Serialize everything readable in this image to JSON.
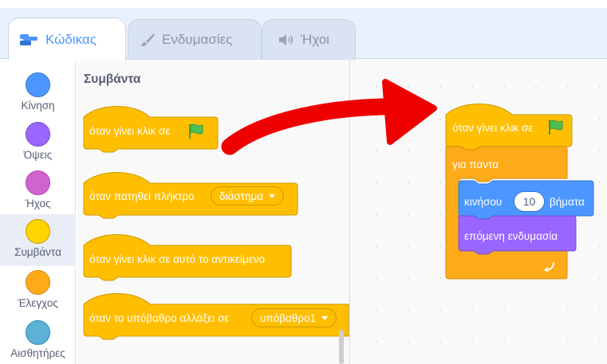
{
  "tabs": [
    {
      "label": "Κώδικας",
      "icon": "code-icon",
      "active": true
    },
    {
      "label": "Ενδυμασίες",
      "icon": "costume-brush-icon",
      "active": false
    },
    {
      "label": "Ήχοι",
      "icon": "sound-icon",
      "active": false
    }
  ],
  "categories": [
    {
      "label": "Κίνηση",
      "color": "#4c97ff"
    },
    {
      "label": "Όψεις",
      "color": "#9966ff"
    },
    {
      "label": "Ήχος",
      "color": "#cf63cf"
    },
    {
      "label": "Συμβάντα",
      "color": "#ffd500",
      "selected": true
    },
    {
      "label": "Έλεγχος",
      "color": "#ffab19"
    },
    {
      "label": "Αισθητήρες",
      "color": "#5cb1d6"
    }
  ],
  "palette": {
    "title": "Συμβάντα",
    "blocks": {
      "flag_clicked": "όταν γίνει κλικ σε",
      "key_pressed": "όταν πατηθεί πλήκτρο",
      "key_value": "διάστημα",
      "sprite_clicked": "όταν γίνει κλικ σε αυτό το αντικείμενο",
      "backdrop_switches": "όταν το υπόβαθρο αλλάξει σε",
      "backdrop_value": "υπόβαθρο1"
    }
  },
  "workspace": {
    "hat": "όταν γίνει κλικ σε",
    "forever": "για πάντα",
    "move_prefix": "κινήσου",
    "move_steps": "10",
    "move_suffix": "βήματα",
    "next_costume": "επόμενη ενδυμασία"
  },
  "colors": {
    "events": "#ffbf00",
    "events_border": "#cc9900",
    "control": "#ffab19",
    "control_border": "#cf8b17",
    "motion": "#4c97ff",
    "motion_border": "#3373cc",
    "looks": "#9966ff",
    "looks_border": "#774dcb",
    "flag": "#4cbf56",
    "arrow": "#ee0000",
    "accent": "#4c97ff"
  }
}
